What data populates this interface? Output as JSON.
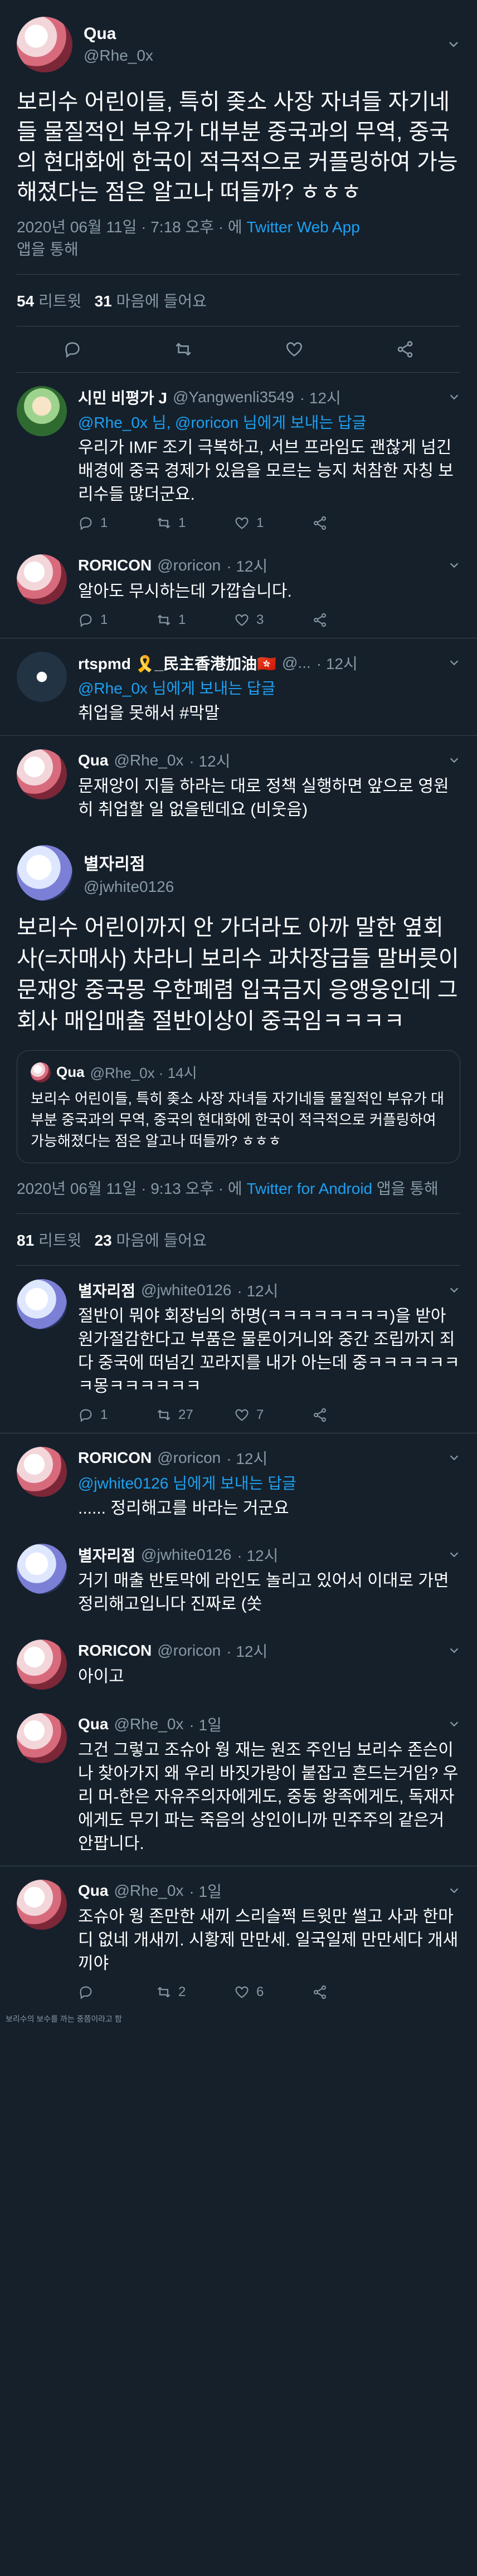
{
  "main_tweet": {
    "display_name": "Qua",
    "handle": "@Rhe_0x",
    "text": "보리수 어린이들, 특히 좆소 사장 자녀들 자기네들 물질적인 부유가 대부분 중국과의 무역, 중국의 현대화에 한국이 적극적으로 커플링하여 가능해졌다는 점은 알고나 떠들까? ㅎㅎㅎ",
    "date": "2020년 06월 11일 · 7:18 오후 · 에 ",
    "client": "Twitter Web App",
    "client_suffix": "앱을 통해",
    "retweets_count": "54",
    "retweets_label": "리트윗",
    "likes_count": "31",
    "likes_label": "마음에 들어요"
  },
  "replies_a": [
    {
      "display_name": "시민 비평가 J",
      "handle": "@Yangwenli3549",
      "time": "· 12시",
      "replying_to": "@Rhe_0x 님, @roricon 님에게 보내는 답글",
      "text": "우리가 IMF 조기 극복하고, 서브 프라임도 괜찮게 넘긴 배경에 중국 경제가 있음을 모르는 능지 처참한 자칭 보리수들 많더군요.",
      "reply_count": "1",
      "retweet_count": "1",
      "like_count": "1"
    },
    {
      "display_name": "RORICON",
      "handle": "@roricon",
      "time": "· 12시",
      "replying_to": "",
      "text": "알아도 무시하는데 가깝습니다.",
      "reply_count": "1",
      "retweet_count": "1",
      "like_count": "3"
    },
    {
      "display_name": "rtspmd 🎗️_民主香港加油🇭🇰",
      "handle": "@...",
      "time": "· 12시",
      "replying_to": "@Rhe_0x 님에게 보내는 답글",
      "text": "취업을 못해서 #막말",
      "reply_count": "",
      "retweet_count": "",
      "like_count": ""
    },
    {
      "display_name": "Qua",
      "handle": "@Rhe_0x",
      "time": "· 12시",
      "replying_to": "",
      "text": "문재앙이 지들 하라는 대로 정책 실행하면 앞으로 영원히 취업할 일 없을텐데요 (비웃음)",
      "reply_count": "",
      "retweet_count": "",
      "like_count": ""
    }
  ],
  "second_tweet": {
    "display_name": "별자리점",
    "handle": "@jwhite0126",
    "text": "보리수 어린이까지 안 가더라도 아까 말한 옆회사(=자매사) 차라니 보리수 과차장급들 말버릇이 문재앙 중국몽 우한폐렴 입국금지 응앵웅인데 그 회사 매입매출 절반이상이 중국임ㅋㅋㅋㅋ",
    "quote_name": "Qua",
    "quote_handle": "@Rhe_0x · 14시",
    "quote_text": "보리수 어린이들, 특히 좆소 사장 자녀들 자기네들 물질적인 부유가 대부분 중국과의 무역, 중국의 현대화에 한국이 적극적으로 커플링하여 가능해졌다는 점은 알고나 떠들까? ㅎㅎㅎ",
    "date": "2020년 06월 11일 · 9:13 오후 · 에 ",
    "client": "Twitter for Android",
    "client_suffix": " 앱을 통해",
    "retweets_count": "81",
    "retweets_label": "리트윗",
    "likes_count": "23",
    "likes_label": "마음에 들어요"
  },
  "replies_b": [
    {
      "display_name": "별자리점",
      "handle": "@jwhite0126",
      "time": "· 12시",
      "replying_to": "",
      "text": "절반이 뭐야 회장님의 하명(ㅋㅋㅋㅋㅋㅋㅋㅋ)을 받아 원가절감한다고 부품은 물론이거니와 중간 조립까지 죄다 중국에 떠넘긴 꼬라지를 내가 아는데 중ㅋㅋㅋㅋㅋㅋㅋ몽ㅋㅋㅋㅋㅋㅋ",
      "reply_count": "1",
      "retweet_count": "27",
      "like_count": "7"
    },
    {
      "display_name": "RORICON",
      "handle": "@roricon",
      "time": "· 12시",
      "replying_to": "@jwhite0126 님에게 보내는 답글",
      "text": "...... 정리해고를 바라는 거군요",
      "reply_count": "",
      "retweet_count": "",
      "like_count": ""
    },
    {
      "display_name": "별자리점",
      "handle": "@jwhite0126",
      "time": "· 12시",
      "replying_to": "",
      "text": "거기 매출 반토막에 라인도 놀리고 있어서 이대로 가면 정리해고입니다 진짜로 (쏫",
      "reply_count": "",
      "retweet_count": "",
      "like_count": ""
    },
    {
      "display_name": "RORICON",
      "handle": "@roricon",
      "time": "· 12시",
      "replying_to": "",
      "text": "아이고",
      "reply_count": "",
      "retweet_count": "",
      "like_count": ""
    },
    {
      "display_name": "Qua",
      "handle": "@Rhe_0x",
      "time": "· 1일",
      "replying_to": "",
      "text": "그건 그렇고 조슈아 웡 재는 원조 주인님 보리수 존슨이나 찾아가지 왜 우리 바짓가랑이 붙잡고 흔드는거임? 우리 머-한은 자유주의자에게도, 중동 왕족에게도, 독재자에게도 무기 파는 죽음의 상인이니까 민주주의 같은거 안팝니다.",
      "reply_count": "",
      "retweet_count": "",
      "like_count": ""
    },
    {
      "display_name": "Qua",
      "handle": "@Rhe_0x",
      "time": "· 1일",
      "replying_to": "",
      "text": "조슈아 웡 존만한 새끼 스리슬쩍 트윗만 썰고 사과 한마디 없네 개새끼. 시황제 만만세. 일국일제 만만세다 개새끼야",
      "reply_count": "",
      "retweet_count": "2",
      "like_count": "6"
    }
  ],
  "footer": "보리수의 보수를 까는 중쯤이라고 함",
  "colors": {
    "background": "#15202b",
    "accent": "#1da1f2",
    "muted": "#8899a6",
    "divider": "#38444d"
  }
}
